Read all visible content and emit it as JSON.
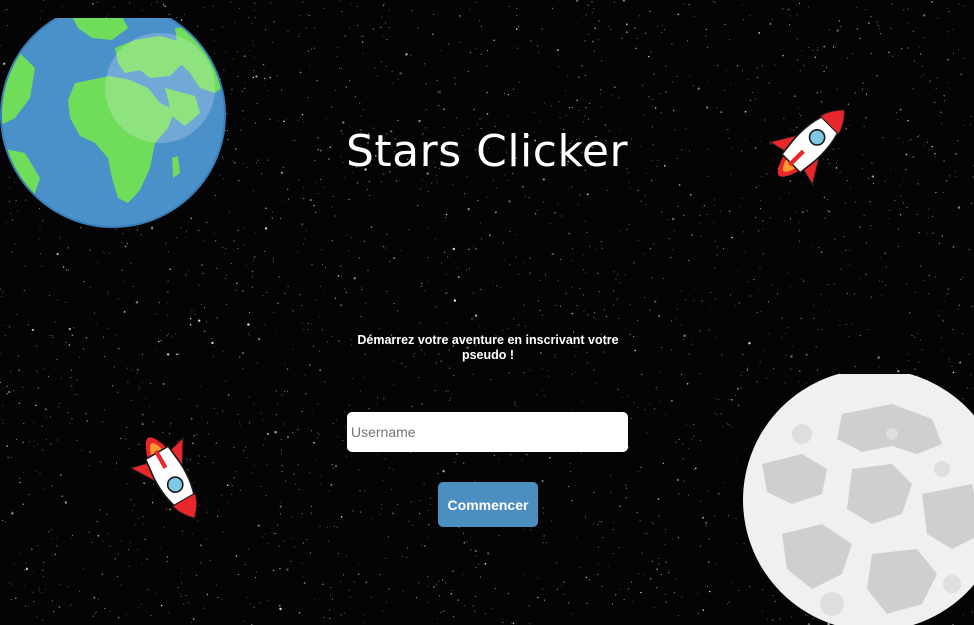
{
  "page": {
    "title": "Stars Clicker",
    "subtitle": "Démarrez votre aventure en inscrivant votre pseudo !"
  },
  "form": {
    "username_placeholder": "Username",
    "username_value": "",
    "submit_label": "Commencer"
  },
  "icons": [
    "earth-icon",
    "moon-icon",
    "rocket-icon"
  ],
  "colors": {
    "background": "#040404",
    "button": "#4d8ec1",
    "text": "#ffffff",
    "earth_ocean": "#4a90c9",
    "earth_land": "#6fdc5a",
    "rocket_red": "#e8262b"
  }
}
